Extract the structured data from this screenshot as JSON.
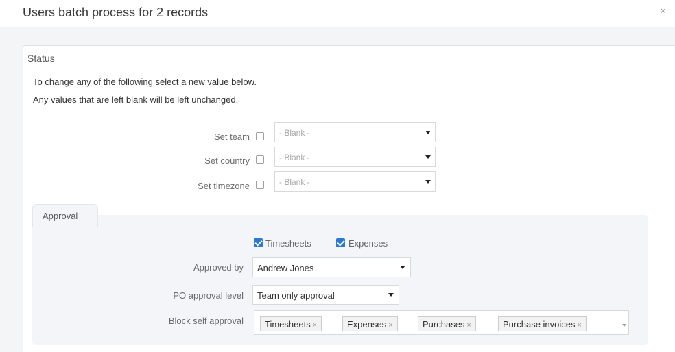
{
  "modal": {
    "title": "Users batch process for 2 records",
    "close_glyph": "×"
  },
  "status": {
    "title": "Status",
    "intro_line1": "To change any of the following select a new value below.",
    "intro_line2": "Any values that are left blank will be left unchanged.",
    "fields": [
      {
        "label": "Set team",
        "checked": false,
        "value": "- Blank -"
      },
      {
        "label": "Set country",
        "checked": false,
        "value": "- Blank -"
      },
      {
        "label": "Set timezone",
        "checked": false,
        "value": "- Blank -"
      }
    ]
  },
  "approval": {
    "title": "Approval",
    "checkboxes": [
      {
        "label": "Timesheets",
        "checked": true
      },
      {
        "label": "Expenses",
        "checked": true
      }
    ],
    "approved_by": {
      "label": "Approved by",
      "value": "Andrew Jones"
    },
    "po_level": {
      "label": "PO approval level",
      "value": "Team only approval"
    },
    "block_self": {
      "label": "Block self approval",
      "tags": [
        "Timesheets",
        "Expenses",
        "Purchases",
        "Purchase invoices"
      ],
      "remove_glyph": "×"
    }
  },
  "colors": {
    "checkbox_checked": "#2b79d6",
    "panel_bg": "#f3f5f8",
    "band_bg": "#f4f5f6"
  }
}
